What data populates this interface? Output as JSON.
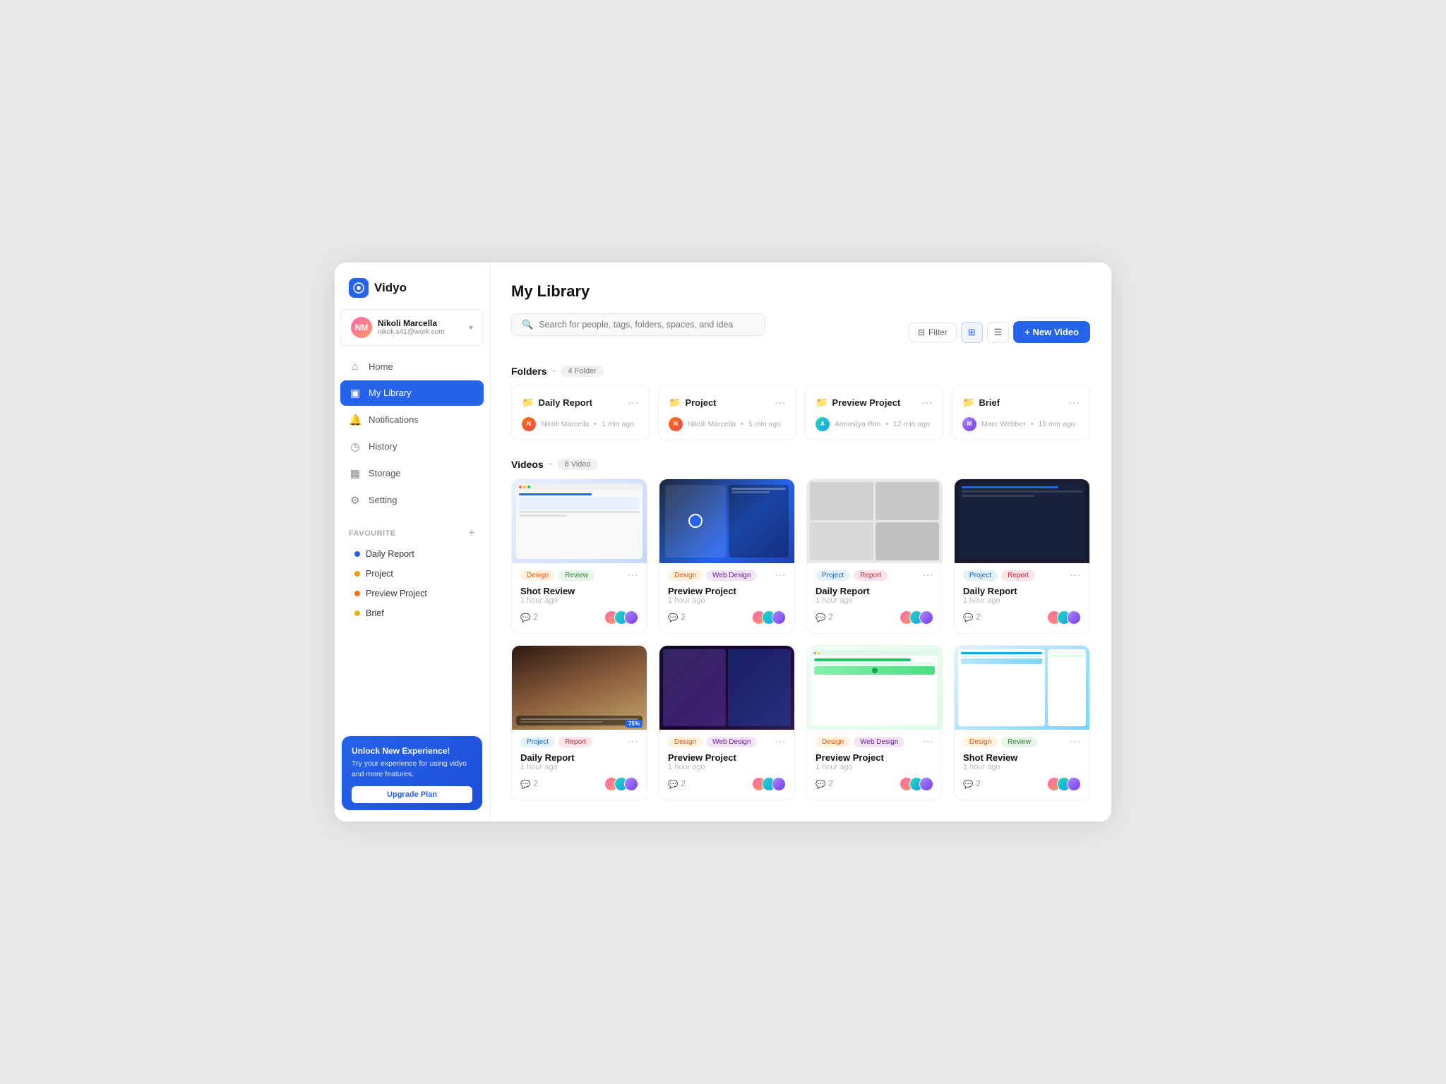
{
  "app": {
    "logo_text": "Vidyo"
  },
  "sidebar": {
    "user": {
      "name": "Nikoli Marcella",
      "email": "nikoli.s41@work.com",
      "initials": "NM"
    },
    "nav_items": [
      {
        "id": "home",
        "label": "Home",
        "icon": "🏠",
        "active": false
      },
      {
        "id": "my-library",
        "label": "My Library",
        "icon": "📚",
        "active": true
      },
      {
        "id": "notifications",
        "label": "Notifications",
        "icon": "🔔",
        "active": false
      },
      {
        "id": "history",
        "label": "History",
        "icon": "🕐",
        "active": false
      },
      {
        "id": "storage",
        "label": "Storage",
        "icon": "🗄️",
        "active": false
      },
      {
        "id": "setting",
        "label": "Setting",
        "icon": "⚙️",
        "active": false
      }
    ],
    "favourite_section": "Favourite",
    "favourites": [
      {
        "label": "Daily Report",
        "color": "#2563eb"
      },
      {
        "label": "Project",
        "color": "#f59e0b"
      },
      {
        "label": "Preview Project",
        "color": "#f97316"
      },
      {
        "label": "Brief",
        "color": "#eab308"
      }
    ],
    "upgrade": {
      "title": "Unlock New Experience!",
      "description": "Try your experience for using vidyo and more features.",
      "button_label": "Upgrade Plan"
    }
  },
  "main": {
    "page_title": "My Library",
    "search_placeholder": "Search for people, tags, folders, spaces, and idea",
    "filter_label": "Filter",
    "new_video_label": "+ New Video",
    "folders_section": "Folders",
    "folders_badge": "4 Folder",
    "videos_section": "Videos",
    "videos_badge": "8 Video",
    "folders": [
      {
        "name": "Daily Report",
        "user": "Nikoli Marcella",
        "time": "1 min ago",
        "avatar_color": "#f97316"
      },
      {
        "name": "Project",
        "user": "Nikoli Marcella",
        "time": "5 min ago",
        "avatar_color": "#f97316"
      },
      {
        "name": "Preview Project",
        "user": "Annastya Rim",
        "time": "12 min ago",
        "avatar_color": "#0ea5e9"
      },
      {
        "name": "Brief",
        "user": "Marc Webber",
        "time": "15 min ago",
        "avatar_color": "#8b5cf6"
      }
    ],
    "videos": [
      {
        "title": "Shot Review",
        "time": "1 hour ago",
        "tags": [
          "Design",
          "Review"
        ],
        "comments": 2,
        "thumb_type": "shot-review"
      },
      {
        "title": "Preview Project",
        "time": "1 hour ago",
        "tags": [
          "Design",
          "Web Design"
        ],
        "comments": 2,
        "thumb_type": "preview-project"
      },
      {
        "title": "Daily Report",
        "time": "1 hour ago",
        "tags": [
          "Project",
          "Report"
        ],
        "comments": 2,
        "thumb_type": "daily-report-1"
      },
      {
        "title": "Daily Report",
        "time": "1 hour ago",
        "tags": [
          "Project",
          "Report"
        ],
        "comments": 2,
        "thumb_type": "daily-report-2"
      },
      {
        "title": "Daily Report",
        "time": "1 hour ago",
        "tags": [
          "Project",
          "Report"
        ],
        "comments": 2,
        "thumb_type": "daily-report-3"
      },
      {
        "title": "Preview Project",
        "time": "1 hour ago",
        "tags": [
          "Design",
          "Web Design"
        ],
        "comments": 2,
        "thumb_type": "preview-2"
      },
      {
        "title": "Preview Project",
        "time": "1 hour ago",
        "tags": [
          "Design",
          "Web Design"
        ],
        "comments": 2,
        "thumb_type": "preview-3"
      },
      {
        "title": "Shot Review",
        "time": "1 hour ago",
        "tags": [
          "Design",
          "Review"
        ],
        "comments": 2,
        "thumb_type": "shot-review-2"
      }
    ]
  }
}
